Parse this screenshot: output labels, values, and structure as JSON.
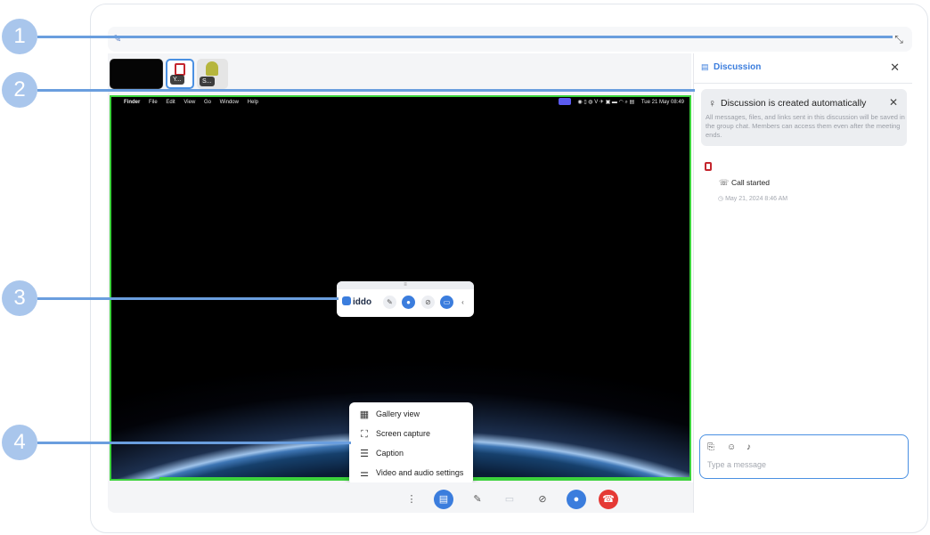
{
  "thumbnails": [
    {
      "label": ""
    },
    {
      "label": "Y..."
    },
    {
      "label": "S..."
    }
  ],
  "shared_screen": {
    "menubar_left": [
      "Finder",
      "File",
      "Edit",
      "View",
      "Go",
      "Window",
      "Help"
    ],
    "menubar_clock": "Tue 21 May 08:49"
  },
  "floating_bar": {
    "logo_text": "iddo",
    "handle": "≡"
  },
  "more_menu": {
    "items": [
      {
        "label": "Gallery view",
        "icon": "grid-icon"
      },
      {
        "label": "Screen capture",
        "icon": "screen-capture-icon"
      },
      {
        "label": "Caption",
        "icon": "caption-icon"
      },
      {
        "label": "Video and audio settings",
        "icon": "sliders-icon"
      }
    ]
  },
  "toolbar": {
    "buttons": [
      "more-icon",
      "chat-icon",
      "pen-icon",
      "screen-share-icon",
      "camera-off-icon",
      "mic-icon",
      "end-call-icon"
    ]
  },
  "discussion": {
    "title": "Discussion",
    "notice_title": "Discussion is created automatically",
    "notice_body": "All messages, files, and links sent in this discussion will be saved in the group chat. Members can access them even after the meeting ends.",
    "call_started": "Call started",
    "call_time": "May 21, 2024 8:46 AM",
    "composer_placeholder": "Type a message"
  },
  "callouts": [
    "1",
    "2",
    "3",
    "4"
  ],
  "colors": {
    "accent": "#3b7ddd",
    "share_border": "#3cd23c",
    "end_call": "#e53935",
    "callout": "#a9c6ec"
  }
}
